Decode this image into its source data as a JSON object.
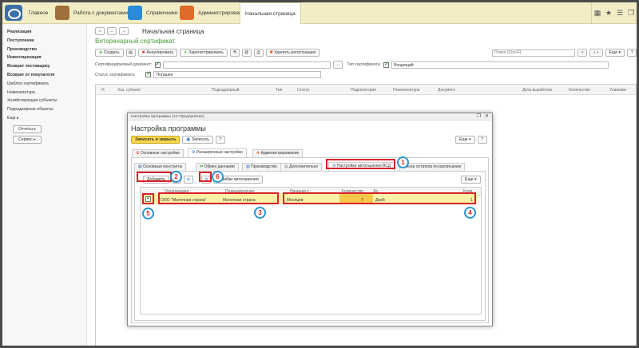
{
  "topbar": {
    "home_label": "Главное",
    "sections": [
      "Работа с документами",
      "Справочники",
      "Администрирование"
    ],
    "active_tab": "Начальная страница",
    "icons": [
      "grid-icon",
      "star-icon",
      "menu-icon",
      "window-icon"
    ]
  },
  "sidebar": {
    "items": [
      {
        "label": "Реализация",
        "bold": true
      },
      {
        "label": "Поступление",
        "bold": true
      },
      {
        "label": "Производство",
        "bold": true
      },
      {
        "label": "Инвентаризация",
        "bold": true
      },
      {
        "label": "Возврат поставщику",
        "bold": true
      },
      {
        "label": "Возврат от покупателя",
        "bold": true
      },
      {
        "label": "Шаблон сертификата",
        "bold": false
      },
      {
        "label": "Номенклатура",
        "bold": false
      },
      {
        "label": "Хозяйствующие субъекты",
        "bold": false
      },
      {
        "label": "Поднадзорные объекты",
        "bold": false
      },
      {
        "label": "Еще ▸",
        "bold": false
      }
    ],
    "buttons": [
      "Отчеты ▸",
      "Сервис ▸"
    ]
  },
  "main": {
    "page_title": "Начальная страница",
    "doc_title": "Ветеринарный сертификат",
    "toolbar": {
      "create": "Создать",
      "annul": "Аннулировать",
      "register": "Зарегистрировать",
      "delete_reg": "Удалить регистрацию",
      "more": "Еще",
      "help": "?"
    },
    "search_placeholder": "Поиск (Ctrl+F)",
    "filters": {
      "cert_doc_label": "Сертифицируемый документ:",
      "cert_type_label": "Тип сертификата:",
      "cert_type_value": "Входящий",
      "status_label": "Статус сертификата:",
      "status_value": "Погашен"
    },
    "columns": [
      "Н",
      "Хоз. субъект",
      "Поднадзорный",
      "Тип",
      "Статус",
      "Подкатегория",
      "Номенклатура",
      "Документ",
      "Дата выработки",
      "Количество",
      "Упаковки"
    ]
  },
  "dialog": {
    "window_title": "Настройка программы (1С:Предприятие)",
    "title": "Настройка программы",
    "save_close": "Записать и закрыть",
    "save": "Записать",
    "help": "?",
    "more": "Еще",
    "tabs": [
      "Основные настройки",
      "Расширенные настройки",
      "Администрирование"
    ],
    "subtabs": [
      "Основные константы",
      "Обмен данными",
      "Производство",
      "Дополнительно",
      "Настройки автогашения ВСД",
      "Синхр остатков по расписанию"
    ],
    "add_button": "Добавить",
    "errors_button": "Ошибки автогашения",
    "table_more": "Еще",
    "columns": [
      "Организация",
      "Подразделение",
      "Начиная с",
      "Количество",
      "До",
      "Коли"
    ],
    "row": {
      "org": "ООО \"Молочная страна\"",
      "dept": "Молочная страна",
      "from": "Месяцев",
      "qty": "7",
      "to": "Дней",
      "count": "1"
    },
    "markers": [
      "1",
      "2",
      "3",
      "4",
      "5",
      "6"
    ]
  },
  "colors": {
    "accent": "#f8d84a",
    "marker_border": "#2a94d4",
    "highlight": "#d8232a",
    "topbar": "#f2edc5"
  }
}
